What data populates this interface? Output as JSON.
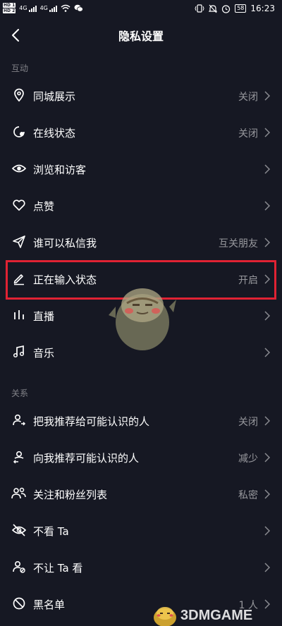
{
  "status_bar": {
    "hd1": "HD 1",
    "hd2": "HD 2",
    "net1": "4G",
    "net2": "4G",
    "battery": "58",
    "time": "16:23"
  },
  "header": {
    "title": "隐私设置"
  },
  "sections": [
    {
      "title": "互动",
      "items": [
        {
          "icon": "location-pin-icon",
          "label": "同城展示",
          "value": "关闭"
        },
        {
          "icon": "online-status-icon",
          "label": "在线状态",
          "value": "关闭"
        },
        {
          "icon": "eye-icon",
          "label": "浏览和访客",
          "value": ""
        },
        {
          "icon": "heart-icon",
          "label": "点赞",
          "value": ""
        },
        {
          "icon": "send-icon",
          "label": "谁可以私信我",
          "value": "互关朋友"
        },
        {
          "icon": "pencil-icon",
          "label": "正在输入状态",
          "value": "开启"
        },
        {
          "icon": "live-bars-icon",
          "label": "直播",
          "value": ""
        },
        {
          "icon": "music-note-icon",
          "label": "音乐",
          "value": ""
        }
      ]
    },
    {
      "title": "关系",
      "items": [
        {
          "icon": "recommend-me-icon",
          "label": "把我推荐给可能认识的人",
          "value": "关闭"
        },
        {
          "icon": "recommend-to-me-icon",
          "label": "向我推荐可能认识的人",
          "value": "减少"
        },
        {
          "icon": "users-icon",
          "label": "关注和粉丝列表",
          "value": "私密"
        },
        {
          "icon": "eye-off-icon",
          "label": "不看 Ta",
          "value": ""
        },
        {
          "icon": "user-block-icon",
          "label": "不让 Ta 看",
          "value": ""
        },
        {
          "icon": "block-icon",
          "label": "黑名单",
          "value": "1 人"
        }
      ]
    }
  ],
  "watermark": "3DMGAME",
  "colors": {
    "background": "#161823",
    "highlight": "#e02233",
    "secondary_text": "#8a8b91"
  }
}
